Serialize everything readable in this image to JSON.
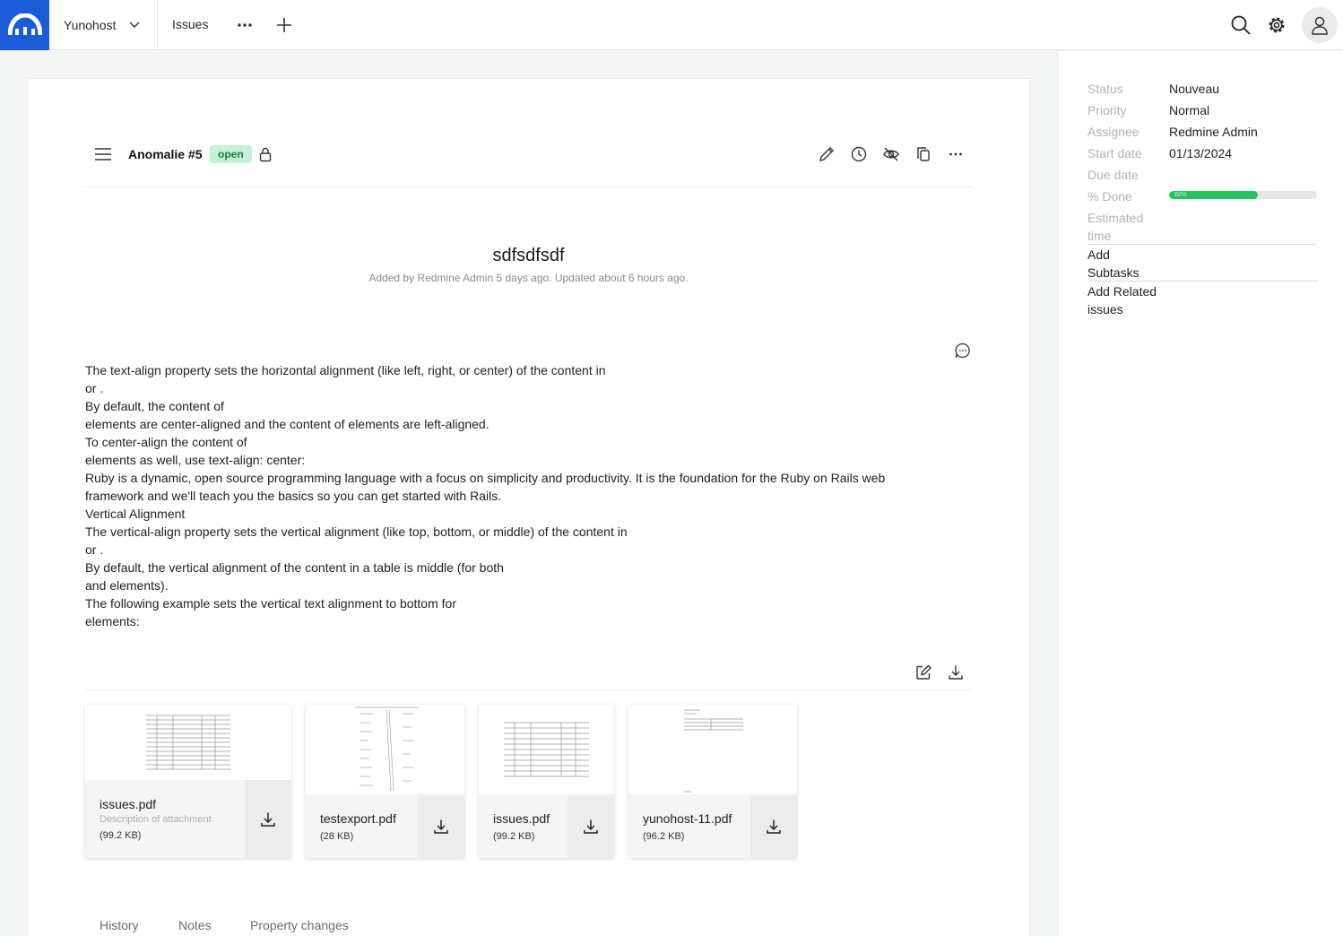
{
  "topbar": {
    "project": "Yunohost",
    "nav_issues": "Issues",
    "icons": [
      "logo-icon",
      "chevron-down-icon",
      "more-icon",
      "plus-icon",
      "search-icon",
      "gear-icon",
      "user-icon"
    ],
    "brand_color": "#1a5bd8"
  },
  "issue": {
    "id_label": "Anomalie #5",
    "status_badge": "open",
    "subject": "sdfsdfsdf",
    "meta": "Added by Redmine Admin 5 days ago. Updated about 6 hours ago.",
    "description_lines": [
      "The text-align property sets the horizontal alignment (like left, right, or center) of the content in",
      "or .",
      "By default, the content of",
      "elements are center-aligned and the content of elements are left-aligned.",
      "To center-align the content of",
      "elements as well, use text-align: center:",
      "Ruby is a dynamic, open source programming language with a focus on simplicity and productivity. It is the foundation for the Ruby on Rails web framework and we'll teach you the basics so you can get started with Rails.",
      "Vertical Alignment",
      "The vertical-align property sets the vertical alignment (like top, bottom, or middle) of the content in",
      "or .",
      "By default, the vertical alignment of the content in a table is middle (for both",
      "and elements).",
      "The following example sets the vertical text alignment to bottom for",
      "elements:"
    ]
  },
  "attachments": [
    {
      "name": "issues.pdf",
      "description": "Description of attachment",
      "size": "(99.2 KB)"
    },
    {
      "name": "testexport.pdf",
      "description": "",
      "size": "(28 KB)"
    },
    {
      "name": "issues.pdf",
      "description": "",
      "size": "(99.2 KB)"
    },
    {
      "name": "yunohost-11.pdf",
      "description": "",
      "size": "(96.2 KB)"
    }
  ],
  "tabs": [
    "History",
    "Notes",
    "Property changes"
  ],
  "sidebar": {
    "attributes": [
      {
        "key": "Status",
        "value": "Nouveau"
      },
      {
        "key": "Priority",
        "value": "Normal"
      },
      {
        "key": "Assignee",
        "value": "Redmine Admin"
      },
      {
        "key": "Start date",
        "value": "01/13/2024"
      },
      {
        "key": "Due date",
        "value": ""
      }
    ],
    "done_label": "% Done",
    "done_percent": 60,
    "done_text": "60%",
    "estimated_label": "Estimated time",
    "subtasks_label": "Add Subtasks",
    "related_label": "Add Related issues",
    "progress_color": "#22c55e"
  }
}
